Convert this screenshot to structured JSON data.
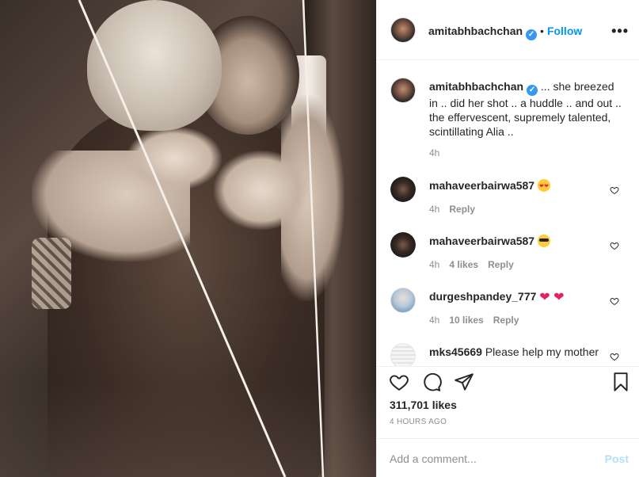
{
  "header": {
    "username": "amitabhbachchan",
    "verified_mark": "✓",
    "separator": "•",
    "follow_label": "Follow",
    "more_label": "•••"
  },
  "caption": {
    "username": "amitabhbachchan",
    "text": "... she breezed in .. did her shot .. a huddle .. and out .. the effervescent, supremely talented, scintillating Alia ..",
    "time": "4h"
  },
  "comments": [
    {
      "username": "mahaveerbairwa587",
      "text": "",
      "emoji": "smiling-face-with-heart-eyes",
      "time": "4h",
      "likes": "",
      "reply": "Reply"
    },
    {
      "username": "mahaveerbairwa587",
      "text": "",
      "emoji": "smiling-face-with-sunglasses",
      "time": "4h",
      "likes": "4 likes",
      "reply": "Reply"
    },
    {
      "username": "durgeshpandey_777",
      "text": "❤ ❤",
      "emoji": "red-heart",
      "time": "4h",
      "likes": "10 likes",
      "reply": "Reply"
    },
    {
      "username": "mks45669",
      "text": "Please help my mother"
    }
  ],
  "actions": {
    "icons": [
      "heart-icon",
      "comment-icon",
      "share-icon",
      "bookmark-icon"
    ],
    "likes": "311,701 likes",
    "timestamp": "4 HOURS AGO"
  },
  "add_comment": {
    "placeholder": "Add a comment...",
    "post_label": "Post"
  },
  "colors": {
    "link_blue": "#0095f6",
    "verified_blue": "#3897f0",
    "muted": "#8e8e8e",
    "post_disabled": "#b2dffc",
    "heart_red": "#e0245e"
  }
}
